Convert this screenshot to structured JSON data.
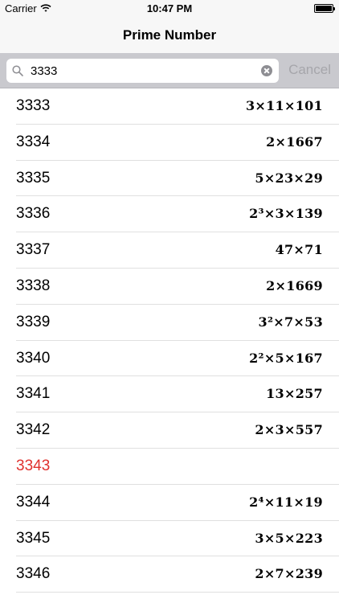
{
  "status": {
    "carrier": "Carrier",
    "time": "10:47 PM"
  },
  "nav": {
    "title": "Prime Number"
  },
  "search": {
    "value": "3333",
    "cancel_label": "Cancel"
  },
  "rows": [
    {
      "number": "3333",
      "factorization": "3×11×101",
      "prime": false
    },
    {
      "number": "3334",
      "factorization": "2×1667",
      "prime": false
    },
    {
      "number": "3335",
      "factorization": "5×23×29",
      "prime": false
    },
    {
      "number": "3336",
      "factorization": "2³×3×139",
      "prime": false
    },
    {
      "number": "3337",
      "factorization": "47×71",
      "prime": false
    },
    {
      "number": "3338",
      "factorization": "2×1669",
      "prime": false
    },
    {
      "number": "3339",
      "factorization": "3²×7×53",
      "prime": false
    },
    {
      "number": "3340",
      "factorization": "2²×5×167",
      "prime": false
    },
    {
      "number": "3341",
      "factorization": "13×257",
      "prime": false
    },
    {
      "number": "3342",
      "factorization": "2×3×557",
      "prime": false
    },
    {
      "number": "3343",
      "factorization": "",
      "prime": true
    },
    {
      "number": "3344",
      "factorization": "2⁴×11×19",
      "prime": false
    },
    {
      "number": "3345",
      "factorization": "3×5×223",
      "prime": false
    },
    {
      "number": "3346",
      "factorization": "2×7×239",
      "prime": false
    }
  ],
  "colors": {
    "prime": "#e0312e",
    "bar": "#f7f7f7",
    "search_bg": "#c9c9ce"
  }
}
